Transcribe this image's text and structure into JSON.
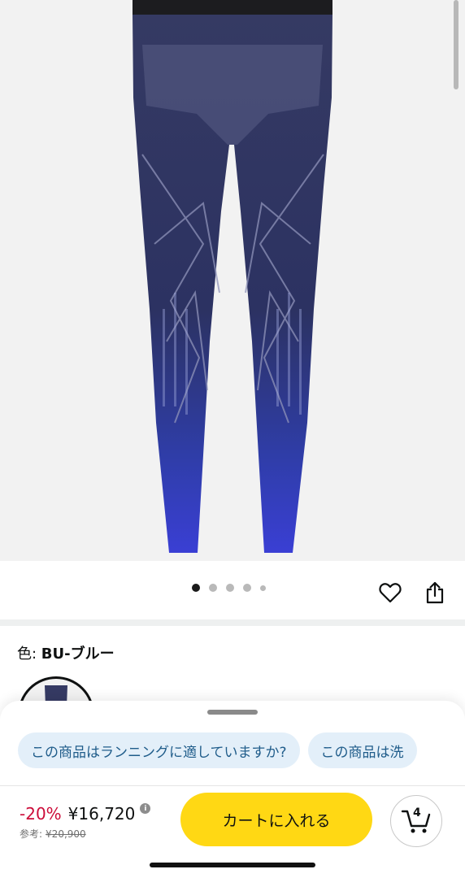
{
  "product": {
    "image_icon": "leggings-product-photo",
    "carousel": {
      "total_images": 5,
      "active_index": 0
    }
  },
  "actions": {
    "wishlist_icon": "heart-icon",
    "share_icon": "share-icon"
  },
  "variant": {
    "color_label": "色: ",
    "color_value": "BU-ブルー"
  },
  "questions": {
    "chips": [
      "この商品はランニングに適していますか?",
      "この商品は洗"
    ]
  },
  "buybox": {
    "discount": "-20%",
    "price": "¥16,720",
    "reference_label": "参考:",
    "reference_price": "¥20,900",
    "add_to_cart_label": "カートに入れる",
    "cart_count": "4",
    "accent_color": "#ffd814",
    "discount_color": "#cc0c39"
  }
}
